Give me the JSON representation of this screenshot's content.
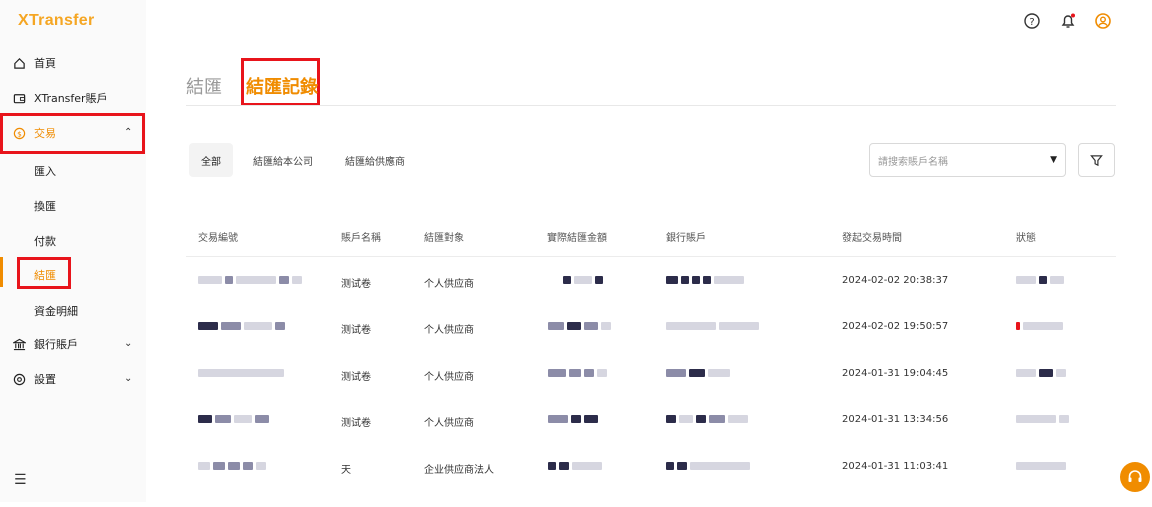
{
  "app": {
    "logo": "XTransfer"
  },
  "sidebar": {
    "items": [
      {
        "label": "首頁"
      },
      {
        "label": "XTransfer賬戶"
      },
      {
        "label": "交易"
      },
      {
        "label": "銀行賬戶"
      },
      {
        "label": "設置"
      }
    ],
    "sub_items": [
      {
        "label": "匯入"
      },
      {
        "label": "換匯"
      },
      {
        "label": "付款"
      },
      {
        "label": "結匯"
      },
      {
        "label": "資金明細"
      }
    ],
    "menu_icon": "☰"
  },
  "tabs": [
    {
      "label": "結匯"
    },
    {
      "label": "結匯記錄"
    }
  ],
  "filters": [
    {
      "label": "全部"
    },
    {
      "label": "結匯給本公司"
    },
    {
      "label": "結匯給供應商"
    }
  ],
  "search": {
    "placeholder": "請搜索賬戶名稱"
  },
  "table": {
    "headers": [
      "交易編號",
      "賬戶名稱",
      "結匯對象",
      "實際結匯金額",
      "銀行賬戶",
      "發起交易時間",
      "狀態"
    ],
    "rows": [
      {
        "account": "测试卷",
        "target": "个人供应商",
        "time": "2024-02-02 20:38:37"
      },
      {
        "account": "测试卷",
        "target": "个人供应商",
        "time": "2024-02-02 19:50:57"
      },
      {
        "account": "测试卷",
        "target": "个人供应商",
        "time": "2024-01-31 19:04:45"
      },
      {
        "account": "测试卷",
        "target": "个人供应商",
        "time": "2024-01-31 13:34:56"
      },
      {
        "account": "天",
        "target": "企业供应商法人",
        "time": "2024-01-31 11:03:41"
      }
    ]
  },
  "colors": {
    "accent": "#f08c00",
    "highlight": "#e8141b"
  },
  "icons": [
    "home-icon",
    "wallet-icon",
    "dollar-icon",
    "bank-icon",
    "settings-icon",
    "help-icon",
    "bell-icon",
    "user-icon",
    "filter-icon",
    "headset-icon"
  ]
}
